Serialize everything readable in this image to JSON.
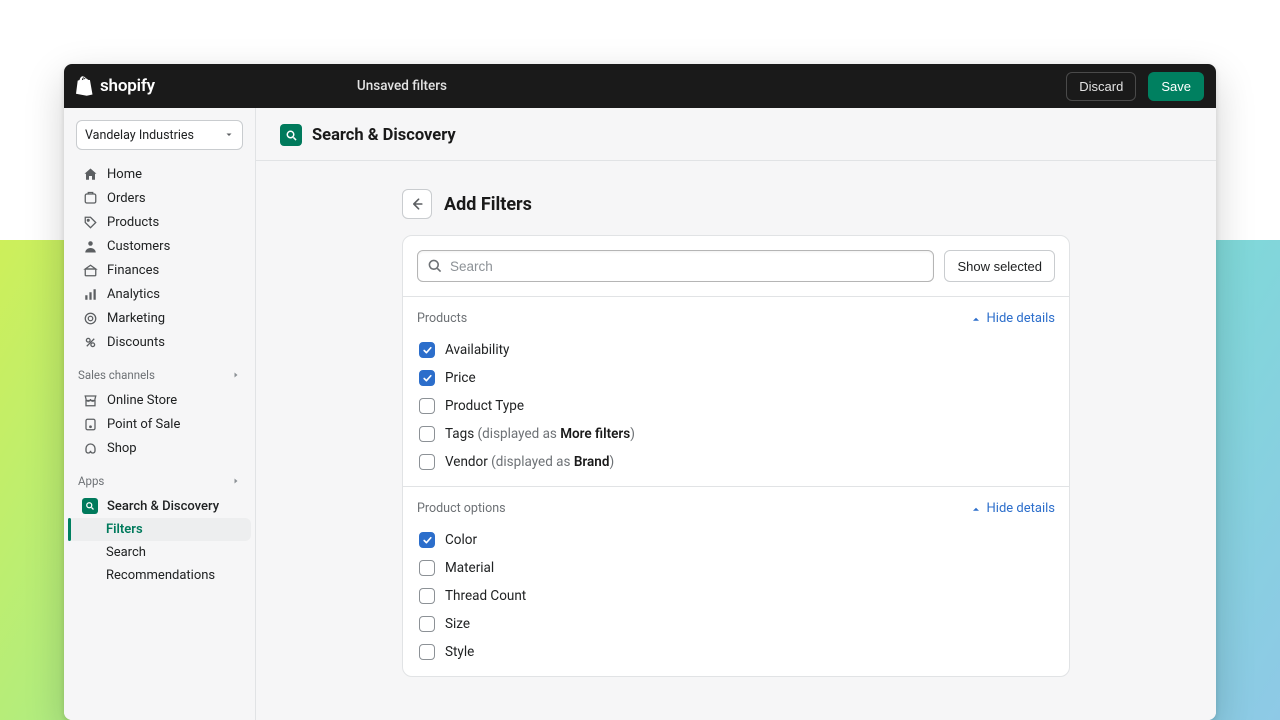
{
  "topbar": {
    "brand": "shopify",
    "status": "Unsaved filters",
    "discard": "Discard",
    "save": "Save"
  },
  "store": {
    "name": "Vandelay Industries"
  },
  "nav": {
    "home": "Home",
    "orders": "Orders",
    "products": "Products",
    "customers": "Customers",
    "finances": "Finances",
    "analytics": "Analytics",
    "marketing": "Marketing",
    "discounts": "Discounts"
  },
  "salesChannels": {
    "heading": "Sales channels",
    "onlineStore": "Online Store",
    "pos": "Point of Sale",
    "shop": "Shop"
  },
  "apps": {
    "heading": "Apps",
    "searchDiscovery": "Search & Discovery",
    "sub": {
      "filters": "Filters",
      "search": "Search",
      "recommendations": "Recommendations"
    }
  },
  "header": {
    "app": "Search & Discovery"
  },
  "page": {
    "title": "Add Filters"
  },
  "search": {
    "placeholder": "Search"
  },
  "actions": {
    "showSelected": "Show selected"
  },
  "sections": [
    {
      "label": "Products",
      "toggle": "Hide details",
      "items": [
        {
          "name": "Availability",
          "checked": true
        },
        {
          "name": "Price",
          "checked": true
        },
        {
          "name": "Product Type",
          "checked": false
        },
        {
          "name": "Tags",
          "checked": false,
          "displayPrefix": " (displayed as ",
          "displayAs": "More filters",
          "displaySuffix": ")"
        },
        {
          "name": "Vendor",
          "checked": false,
          "displayPrefix": " (displayed as ",
          "displayAs": "Brand",
          "displaySuffix": ")"
        }
      ]
    },
    {
      "label": "Product options",
      "toggle": "Hide details",
      "items": [
        {
          "name": "Color",
          "checked": true
        },
        {
          "name": "Material",
          "checked": false
        },
        {
          "name": "Thread Count",
          "checked": false
        },
        {
          "name": "Size",
          "checked": false
        },
        {
          "name": "Style",
          "checked": false
        }
      ]
    }
  ]
}
